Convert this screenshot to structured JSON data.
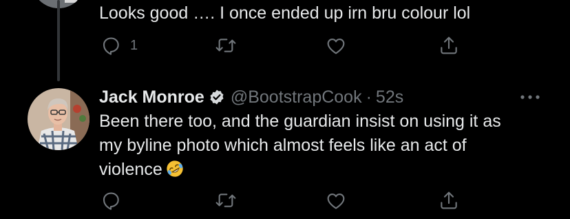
{
  "previous_tweet": {
    "text": "Looks good …. I once ended up irn bru colour lol",
    "actions": {
      "reply_count": "1",
      "retweet_count": "",
      "like_count": ""
    }
  },
  "tweet": {
    "display_name": "Jack Monroe",
    "handle": "@BootstrapCook",
    "separator": "·",
    "timestamp": "52s",
    "body_lines": [
      "Been there too, and the guardian insist on using it as",
      "my byline photo which almost feels like an act of",
      "violence"
    ],
    "emoji": "rolling-on-floor-laughing-emoji",
    "actions": {
      "reply_count": "",
      "retweet_count": "",
      "like_count": ""
    }
  },
  "icons": {
    "reply": "reply-icon",
    "retweet": "retweet-icon",
    "like": "heart-icon",
    "share": "share-icon",
    "verified": "verified-badge-icon",
    "more": "more-options-icon"
  },
  "colors": {
    "background": "#000000",
    "text_primary": "#e7e9ea",
    "text_secondary": "#71767b",
    "thread_line": "#333639"
  }
}
